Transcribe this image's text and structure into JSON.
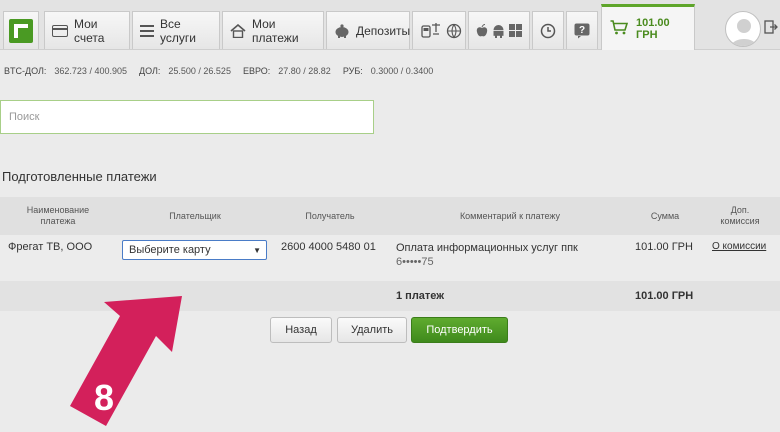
{
  "nav": {
    "tabs": [
      {
        "label": "Мои счета",
        "icon": "card-icon"
      },
      {
        "label": "Все услуги",
        "icon": "list-icon"
      },
      {
        "label": "Мои платежи",
        "icon": "home-icon"
      },
      {
        "label": "Депозиты",
        "icon": "piggy-bank-icon"
      }
    ],
    "cart_amount": "101.00 ГРН",
    "accent": "#5ea52a"
  },
  "rates": [
    {
      "label": "BTC-ДОЛ:",
      "value": "362.723 / 400.905"
    },
    {
      "label": "ДОЛ:",
      "value": "25.500 / 26.525"
    },
    {
      "label": "ЕВРО:",
      "value": "27.80 / 28.82"
    },
    {
      "label": "РУБ:",
      "value": "0.3000 / 0.3400"
    }
  ],
  "search": {
    "placeholder": "Поиск",
    "value": ""
  },
  "section_title": "Подготовленные платежи",
  "table": {
    "headers": {
      "name": "Наименование платежа",
      "payer": "Плательщик",
      "recipient": "Получатель",
      "comment": "Комментарий к платежу",
      "amount": "Сумма",
      "commission": "Доп. комиссия"
    },
    "rows": [
      {
        "name": "Фрегат ТВ, ООО",
        "payer_select": "Выберите карту",
        "recipient": "2600 4000 5480 01",
        "comment": "Оплата информационных услуг ппк",
        "comment_line2": "6•••••75",
        "amount": "101.00 ГРН",
        "commission_link": "О комиссии"
      }
    ],
    "footer": {
      "count": "1 платеж",
      "total": "101.00 ГРН"
    }
  },
  "buttons": {
    "back": "Назад",
    "delete": "Удалить",
    "confirm": "Подтвердить"
  },
  "annotation": {
    "step_number": "8",
    "color": "#d3205b"
  }
}
